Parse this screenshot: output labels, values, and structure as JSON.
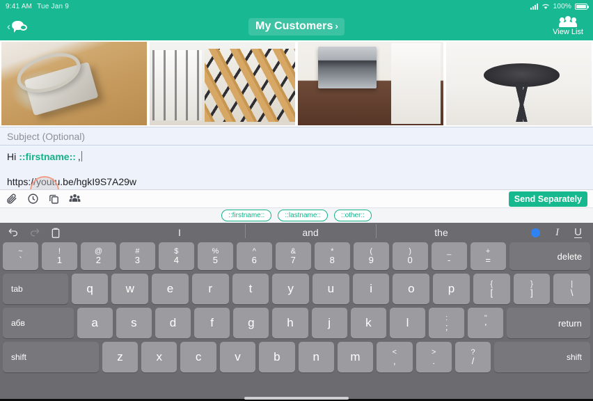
{
  "status_bar": {
    "time": "9:41 AM",
    "date": "Tue Jan 9",
    "battery_percent": "100%",
    "signal_icon": "cellular-signal-icon",
    "wifi_icon": "wifi-icon",
    "battery_icon": "battery-icon"
  },
  "navbar": {
    "back_icon": "chat-bubble-icon",
    "back_chevron": "‹",
    "title": "My Customers",
    "title_chevron": "›",
    "right_action_label": "View List",
    "right_action_icon": "group-people-icon",
    "accent_color": "#17b892"
  },
  "photo_strip": {
    "photos": [
      {
        "name": "house-keys-on-wood-floor"
      },
      {
        "name": "interior-hallway-white"
      },
      {
        "name": "wooden-staircase-railing"
      },
      {
        "name": "kitchen-oven-dark-floor"
      },
      {
        "name": "black-stool-interior"
      }
    ]
  },
  "compose": {
    "subject_placeholder": "Subject (Optional)",
    "body_greeting": "Hi",
    "body_merge_field": "::firstname::",
    "body_comma": ",",
    "body_url": "https://youtu.be/hgkI9S7A29w",
    "tool_icons": [
      {
        "name": "attach-paperclip-icon"
      },
      {
        "name": "schedule-clock-icon"
      },
      {
        "name": "duplicate-copy-icon"
      },
      {
        "name": "recipients-group-icon"
      }
    ],
    "send_button_label": "Send Separately",
    "send_button_color": "#16b98e",
    "merge_chips": [
      "::firstname::",
      "::lastname::",
      "::other::"
    ],
    "chip_color": "#12b389"
  },
  "keyboard": {
    "suggestion_icons": [
      {
        "name": "undo-icon"
      },
      {
        "name": "redo-icon"
      },
      {
        "name": "paste-clipboard-icon"
      }
    ],
    "suggestions": [
      "I",
      "and",
      "the"
    ],
    "format_icons": [
      {
        "name": "bold-icon",
        "active": true,
        "color": "#2f82f2"
      },
      {
        "name": "italic-icon",
        "glyph": "I"
      },
      {
        "name": "underline-icon",
        "glyph": "U"
      }
    ],
    "row_numbers": [
      {
        "top": "~",
        "bot": "`"
      },
      {
        "top": "!",
        "bot": "1"
      },
      {
        "top": "@",
        "bot": "2"
      },
      {
        "top": "#",
        "bot": "3"
      },
      {
        "top": "$",
        "bot": "4"
      },
      {
        "top": "%",
        "bot": "5"
      },
      {
        "top": "^",
        "bot": "6"
      },
      {
        "top": "&",
        "bot": "7"
      },
      {
        "top": "*",
        "bot": "8"
      },
      {
        "top": "(",
        "bot": "9"
      },
      {
        "top": ")",
        "bot": "0"
      },
      {
        "top": "_",
        "bot": "-"
      },
      {
        "top": "+",
        "bot": "="
      }
    ],
    "delete_label": "delete",
    "tab_label": "tab",
    "row_top": [
      "q",
      "w",
      "e",
      "r",
      "t",
      "y",
      "u",
      "i",
      "o",
      "p"
    ],
    "row_top_extra": [
      {
        "top": "{",
        "bot": "["
      },
      {
        "top": "}",
        "bot": "]"
      },
      {
        "top": "|",
        "bot": "\\"
      }
    ],
    "caps_label": "абв",
    "row_home": [
      "a",
      "s",
      "d",
      "f",
      "g",
      "h",
      "j",
      "k",
      "l"
    ],
    "row_home_extra": [
      {
        "top": ":",
        "bot": ";"
      },
      {
        "top": "\"",
        "bot": "'"
      }
    ],
    "return_label": "return",
    "shift_label": "shift",
    "row_bottom": [
      "z",
      "x",
      "c",
      "v",
      "b",
      "n",
      "m"
    ],
    "row_bottom_extra": [
      {
        "top": "<",
        "bot": ","
      },
      {
        "top": ">",
        "bot": "."
      },
      {
        "top": "?",
        "bot": "/"
      }
    ]
  }
}
